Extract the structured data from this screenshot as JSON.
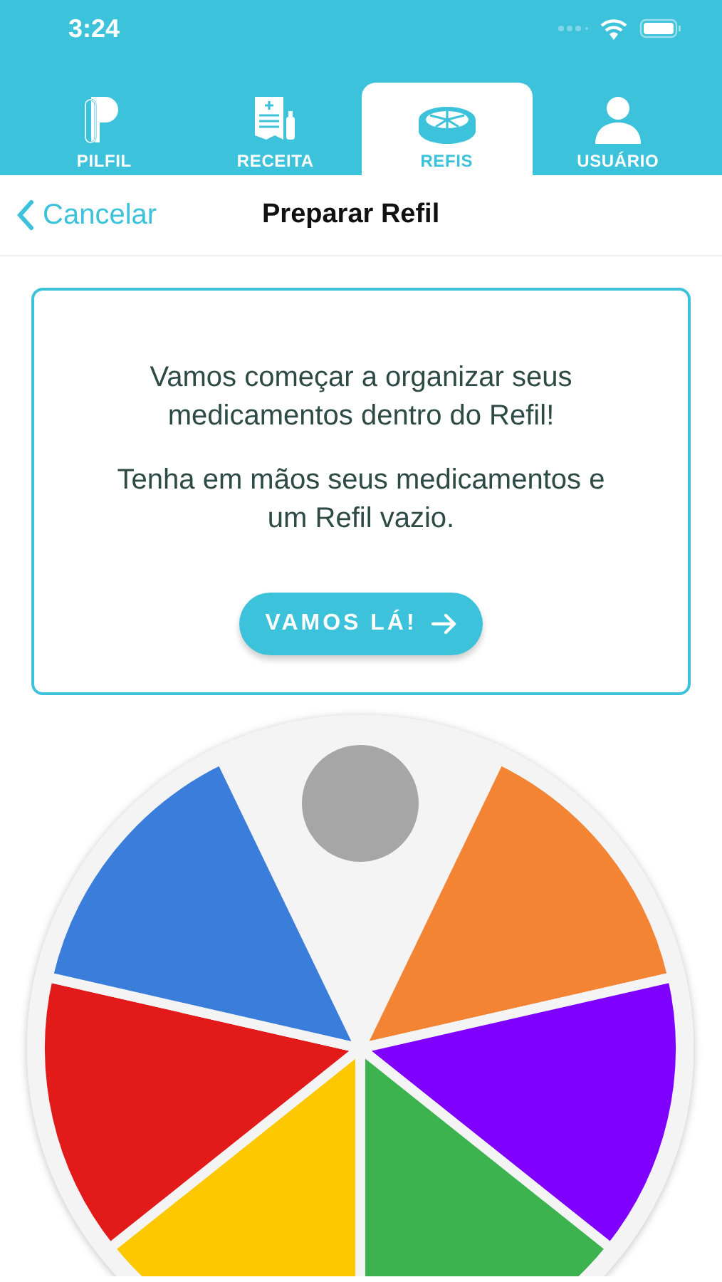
{
  "status_bar": {
    "time": "3:24"
  },
  "tabs": [
    {
      "label": "PILFIL",
      "selected": false
    },
    {
      "label": "RECEITA",
      "selected": false
    },
    {
      "label": "REFIS",
      "selected": true
    },
    {
      "label": "USUÁRIO",
      "selected": false
    }
  ],
  "nav": {
    "back": "Cancelar",
    "title": "Preparar Refil"
  },
  "card": {
    "paragraphs": [
      "Vamos começar a organizar seus medicamentos dentro do Refil!",
      "Tenha em mãos seus medicamentos e um Refil vazio."
    ],
    "button": "VAMOS LÁ!"
  },
  "refill": {
    "compartments": [
      {
        "kind": "marker",
        "color": "#f4f4f4"
      },
      {
        "kind": "slot",
        "color": "#f38434"
      },
      {
        "kind": "slot",
        "color": "#8000ff"
      },
      {
        "kind": "slot",
        "color": "#3db34f"
      },
      {
        "kind": "slot",
        "color": "#fdc800"
      },
      {
        "kind": "slot",
        "color": "#e21a1a"
      },
      {
        "kind": "slot",
        "color": "#3b7ddb"
      }
    ]
  }
}
